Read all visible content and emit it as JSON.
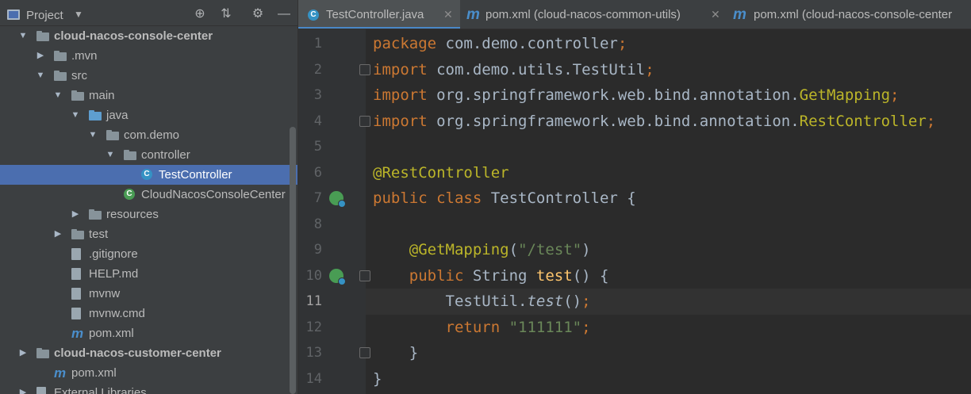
{
  "project": {
    "title": "Project",
    "icons": [
      "locate-icon",
      "collapse-icon",
      "gear-icon",
      "minimize-icon"
    ],
    "tree": [
      {
        "label": "cloud-nacos-console-center",
        "depth": 0,
        "expanded": true,
        "bold": true,
        "icon": "module-folder-icon"
      },
      {
        "label": ".mvn",
        "depth": 1,
        "expanded": false,
        "icon": "folder-icon"
      },
      {
        "label": "src",
        "depth": 1,
        "expanded": true,
        "icon": "folder-icon"
      },
      {
        "label": "main",
        "depth": 2,
        "expanded": true,
        "icon": "folder-icon"
      },
      {
        "label": "java",
        "depth": 3,
        "expanded": true,
        "icon": "source-folder-icon"
      },
      {
        "label": "com.demo",
        "depth": 4,
        "expanded": true,
        "icon": "package-icon"
      },
      {
        "label": "controller",
        "depth": 5,
        "expanded": true,
        "icon": "package-icon"
      },
      {
        "label": "TestController",
        "depth": 6,
        "selected": true,
        "icon": "class-icon"
      },
      {
        "label": "CloudNacosConsoleCenter",
        "depth": 5,
        "icon": "spring-class-icon"
      },
      {
        "label": "resources",
        "depth": 3,
        "expanded": false,
        "icon": "resources-folder-icon"
      },
      {
        "label": "test",
        "depth": 2,
        "expanded": false,
        "icon": "folder-icon"
      },
      {
        "label": ".gitignore",
        "depth": 2,
        "icon": "file-icon"
      },
      {
        "label": "HELP.md",
        "depth": 2,
        "icon": "markdown-icon"
      },
      {
        "label": "mvnw",
        "depth": 2,
        "icon": "shell-icon"
      },
      {
        "label": "mvnw.cmd",
        "depth": 2,
        "icon": "file-icon"
      },
      {
        "label": "pom.xml",
        "depth": 2,
        "icon": "maven-icon"
      },
      {
        "label": "cloud-nacos-customer-center",
        "depth": 0,
        "expanded": false,
        "bold": true,
        "icon": "module-folder-icon"
      },
      {
        "label": "pom.xml",
        "depth": 1,
        "icon": "maven-icon"
      },
      {
        "label": "External Libraries",
        "depth": 0,
        "expanded": false,
        "icon": "library-icon"
      }
    ]
  },
  "tabs": [
    {
      "label": "TestController.java",
      "active": true,
      "icon": "class-icon"
    },
    {
      "label": "pom.xml (cloud-nacos-common-utils)",
      "active": false,
      "icon": "maven-icon"
    },
    {
      "label": "pom.xml (cloud-nacos-console-center",
      "active": false,
      "icon": "maven-icon"
    }
  ],
  "editor": {
    "current_line": 11,
    "lines": [
      {
        "n": "1",
        "tokens": [
          [
            "kw",
            "package "
          ],
          [
            "ty",
            "com.demo.controller"
          ],
          [
            "kw",
            ";"
          ]
        ]
      },
      {
        "n": "2",
        "tokens": [
          [
            "kw",
            "import "
          ],
          [
            "ty",
            "com.demo.utils."
          ],
          [
            "ty",
            "TestUtil"
          ],
          [
            "kw",
            ";"
          ]
        ]
      },
      {
        "n": "3",
        "tokens": [
          [
            "kw",
            "import "
          ],
          [
            "ty",
            "org.springframework.web.bind.annotation."
          ],
          [
            "an",
            "GetMapping"
          ],
          [
            "kw",
            ";"
          ]
        ]
      },
      {
        "n": "4",
        "tokens": [
          [
            "kw",
            "import "
          ],
          [
            "ty",
            "org.springframework.web.bind.annotation."
          ],
          [
            "an",
            "RestController"
          ],
          [
            "kw",
            ";"
          ]
        ]
      },
      {
        "n": "5",
        "tokens": []
      },
      {
        "n": "6",
        "tokens": [
          [
            "an",
            "@RestController"
          ]
        ]
      },
      {
        "n": "7",
        "tokens": [
          [
            "kw",
            "public class "
          ],
          [
            "ty",
            "TestController {"
          ]
        ]
      },
      {
        "n": "8",
        "tokens": []
      },
      {
        "n": "9",
        "tokens": [
          [
            "ty",
            "    "
          ],
          [
            "an",
            "@GetMapping"
          ],
          [
            "ty",
            "("
          ],
          [
            "st",
            "\"/test\""
          ],
          [
            "ty",
            ")"
          ]
        ]
      },
      {
        "n": "10",
        "tokens": [
          [
            "ty",
            "    "
          ],
          [
            "kw",
            "public "
          ],
          [
            "ty",
            "String "
          ],
          [
            "fn",
            "test"
          ],
          [
            "ty",
            "() {"
          ]
        ]
      },
      {
        "n": "11",
        "tokens": [
          [
            "ty",
            "        TestUtil."
          ],
          [
            "it",
            "test"
          ],
          [
            "ty",
            "()"
          ],
          [
            "kw",
            ";"
          ]
        ]
      },
      {
        "n": "12",
        "tokens": [
          [
            "ty",
            "        "
          ],
          [
            "kw",
            "return "
          ],
          [
            "st",
            "\"111111\""
          ],
          [
            "kw",
            ";"
          ]
        ]
      },
      {
        "n": "13",
        "tokens": [
          [
            "ty",
            "    }"
          ]
        ]
      },
      {
        "n": "14",
        "tokens": [
          [
            "ty",
            "}"
          ]
        ]
      }
    ]
  },
  "colors": {
    "keyword": "#cc7832",
    "annotation": "#bbb529",
    "string": "#6a8759",
    "method": "#ffc66d",
    "selection": "#4b6eaf"
  }
}
